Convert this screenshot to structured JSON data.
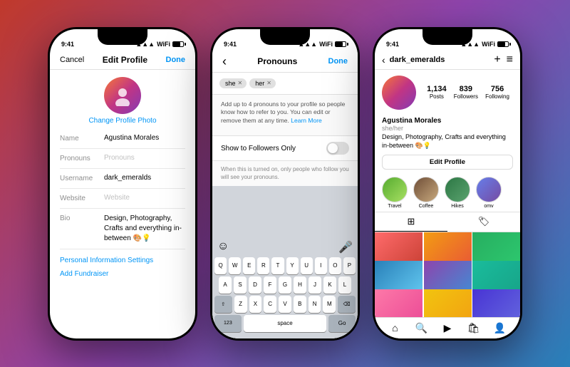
{
  "background": "linear-gradient(135deg, #c0392b, #8e44ad, #2980b9)",
  "phone1": {
    "status_time": "9:41",
    "nav": {
      "cancel": "Cancel",
      "title": "Edit Profile",
      "done": "Done"
    },
    "photo_label": "Change Profile Photo",
    "fields": [
      {
        "label": "Name",
        "value": "Agustina Morales",
        "placeholder": false
      },
      {
        "label": "Pronouns",
        "value": "Pronouns",
        "placeholder": true
      },
      {
        "label": "Username",
        "value": "dark_emeralds",
        "placeholder": false
      },
      {
        "label": "Website",
        "value": "Website",
        "placeholder": true
      },
      {
        "label": "Bio",
        "value": "Design, Photography, Crafts and everything in-between 🎨💡",
        "placeholder": false,
        "multiline": true
      }
    ],
    "links": [
      "Personal Information Settings",
      "Add Fundraiser"
    ]
  },
  "phone2": {
    "status_time": "9:41",
    "nav": {
      "back": "‹",
      "title": "Pronouns",
      "done": "Done"
    },
    "tags": [
      "she",
      "her"
    ],
    "description": "Add up to 4 pronouns to your profile so people know how to refer to you. You can edit or remove them at any time.",
    "learn_more": "Learn More",
    "toggle_label": "Show to Followers Only",
    "toggle_desc": "When this is turned on, only people who follow you will see your pronouns.",
    "keyboard": {
      "rows": [
        [
          "Q",
          "W",
          "E",
          "R",
          "T",
          "Y",
          "U",
          "I",
          "O",
          "P"
        ],
        [
          "A",
          "S",
          "D",
          "F",
          "G",
          "H",
          "J",
          "K",
          "L"
        ],
        [
          "⇧",
          "Z",
          "X",
          "C",
          "V",
          "B",
          "N",
          "M",
          "⌫"
        ],
        [
          "123",
          "space",
          "Go"
        ]
      ]
    }
  },
  "phone3": {
    "status_time": "9:41",
    "nav": {
      "back": "‹",
      "username": "dark_emeralds",
      "add_icon": "+",
      "menu_icon": "≡"
    },
    "stats": [
      {
        "number": "1,134",
        "label": "Posts"
      },
      {
        "number": "839",
        "label": "Followers"
      },
      {
        "number": "756",
        "label": "Following"
      }
    ],
    "bio": {
      "name": "Agustina Morales",
      "pronouns": "she/her",
      "text": "Design, Photography, Crafts and everything in-between"
    },
    "edit_profile": "Edit Profile",
    "highlights": [
      {
        "label": "Travel",
        "color": "travel"
      },
      {
        "label": "Coffee",
        "color": "coffee"
      },
      {
        "label": "Hikes",
        "color": "hikes"
      },
      {
        "label": "omv",
        "color": "omv"
      }
    ],
    "grid_cells": [
      "red",
      "orange",
      "green",
      "blue",
      "purple",
      "teal",
      "pink",
      "yellow",
      "indigo"
    ]
  }
}
